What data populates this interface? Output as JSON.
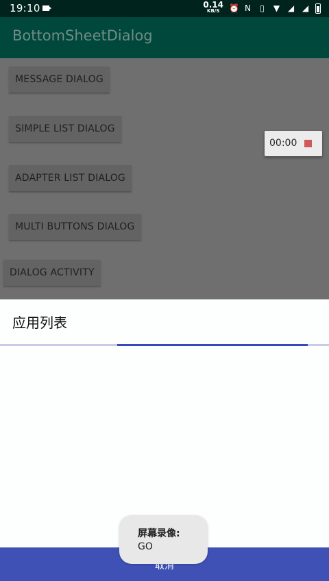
{
  "status_bar": {
    "time": "19:10",
    "net_speed_value": "0.14",
    "net_speed_unit": "KB/S",
    "icons": [
      "screen-record-icon",
      "alarm-icon",
      "nfc-icon",
      "vibrate-icon",
      "wifi-icon",
      "signal-icon",
      "signal-icon",
      "battery-icon"
    ]
  },
  "app_bar": {
    "title": "BottomSheetDialog"
  },
  "buttons": {
    "message": "MESSAGE DIALOG",
    "simple_list": "SIMPLE LIST DIALOG",
    "adapter_list": "ADAPTER LIST DIALOG",
    "multi_buttons": "MULTI BUTTONS DIALOG",
    "dialog_activity": "DIALOG ACTIVITY"
  },
  "recorder": {
    "elapsed": "00:00"
  },
  "sheet": {
    "title": "应用列表",
    "cancel_label": "取消"
  },
  "toast": {
    "line1": "屏幕录像:",
    "line2": "GO"
  },
  "colors": {
    "status_bar": "#00231d",
    "app_bar": "#00473c",
    "accent": "#3f51b5",
    "scrim": "#6f6f6f"
  }
}
